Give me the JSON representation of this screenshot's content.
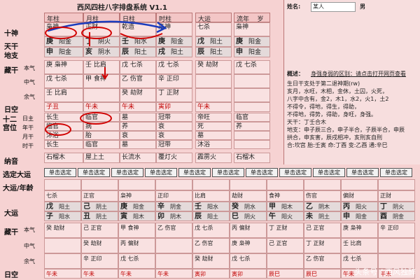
{
  "app": {
    "title": "西风四柱八字排盘系统 V1.1"
  },
  "top": {
    "pillar_headers": [
      "年柱",
      "月柱",
      "日柱",
      "时柱"
    ],
    "dayun_header": "大运",
    "liunian_header": "流年",
    "liunian_value": "岁",
    "name_label": "姓名:",
    "name_value": "某人",
    "gender": "男"
  },
  "left_labels": {
    "shishen": "十神",
    "tiangan": "天干",
    "dizhi": "地支",
    "canggan": "藏干",
    "benqi": "本气",
    "zhongqi": "中气",
    "yuqi": "余气",
    "rikong": "日空",
    "shier": "十二宫位",
    "rizhu": "日主",
    "nianzhu": "年干",
    "yuezhu": "月干",
    "shizhu": "时干",
    "nayin": "纳音",
    "xuanding": "选定大运",
    "dayun_nianling": "大运/年龄",
    "dayun2": "大运",
    "canggan2": "藏干",
    "benqi2": "本气",
    "zhongqi2": "中气",
    "yuqi2": "余气",
    "rikong2": "日空"
  },
  "pillars": [
    {
      "shishen": "枭神",
      "gan": "庚",
      "gan_wx": "阳金",
      "zhi": "申",
      "zhi_wx": "阳金",
      "cang": [
        "庚 枭神",
        "戊 七杀",
        "壬 比肩"
      ],
      "kong": "子丑",
      "s1": "长生",
      "s2": "临官",
      "s3": "沐浴",
      "s4": "长生",
      "nayin": "石榴木"
    },
    {
      "shishen": "正财",
      "gan": "丁",
      "gan_wx": "阴火",
      "zhi": "亥",
      "zhi_wx": "阴水",
      "cang": [
        "壬 比肩",
        "甲 食神",
        ""
      ],
      "kong": "午未",
      "s1": "临官",
      "s2": "病",
      "s3": "胎",
      "s4": "临官",
      "nayin": "屋上土"
    },
    {
      "shishen": "乾造",
      "gan": "壬",
      "gan_wx": "阳水",
      "zhi": "辰",
      "zhi_wx": "阳土",
      "cang": [
        "戊 七杀",
        "乙 伤官",
        "癸 劫财"
      ],
      "kong": "午未",
      "s1": "墓",
      "s2": "养",
      "s3": "衰",
      "s4": "墓",
      "nayin": "长流水"
    },
    {
      "shishen": "枭神",
      "gan": "庚",
      "gan_wx": "阳金",
      "zhi": "戌",
      "zhi_wx": "阳土",
      "cang": [
        "戊 七杀",
        "辛 正印",
        "丁 正财"
      ],
      "kong": "寅卯",
      "s1": "冠带",
      "s2": "衰",
      "s3": "衰",
      "s4": "冠带",
      "nayin": "覆灯火"
    }
  ],
  "dayun_col": {
    "shishen": "七杀",
    "gan": "戊",
    "gan_wx": "阳土",
    "zhi": "辰",
    "zhi_wx": "阳土",
    "cang": [
      "癸 劫财"
    ],
    "kong": "午未",
    "s1": "帝旺",
    "s2": "死",
    "s3": "墓",
    "s4": "沐浴",
    "nayin": "霹雳火"
  },
  "liunian_col": {
    "shishen": "枭神",
    "gan": "庚",
    "gan_wx": "阳金",
    "zhi": "申",
    "zhi_wx": "阳金",
    "cang": [
      "戊 七杀"
    ],
    "kong": "",
    "s1": "临官",
    "s2": "养",
    "s3": "",
    "s4": "",
    "nayin": "石榴木"
  },
  "info": {
    "line1": "概述：",
    "line1b": "身强身弱的区别：请点击打开网页查看",
    "lines": [
      "生日干支处于第二退神期(rw)",
      "亥月，水旺，木相，金休，土囚，火死，",
      "八字中含有，金2，木1，水2，火1，土2",
      "不得令，得地，得生，得助，",
      "不得地，得势，得助，身旺，身强。",
      "天干：丁壬合木",
      "地支：申子辰三合，申子半合，子辰半合，申辰",
      "拱合，申亥害，辰戌相冲，亥刑亥自刑",
      "合:坎宫  胎:壬寅  命:丁酉  变:乙酉  通:辛巳"
    ],
    "mingzhu": "命:坎宫  胎:壬寅  命:丁酉  变:乙酉  通:辛巳"
  },
  "select_buttons": [
    "单击选定",
    "单击选定",
    "单击选定",
    "单击选定",
    "单击选定",
    "单击选定",
    "单击选定",
    "单击选定",
    "单击选定",
    "单击选定",
    "单击选定"
  ],
  "dayun_table": {
    "cols": [
      {
        "shishen": "七杀",
        "gan": "戊",
        "gw": "阳土",
        "zhi": "子",
        "zw": "阳水",
        "c": [
          "癸 劫财"
        ],
        "kong": "午未"
      },
      {
        "shishen": "正官",
        "gan": "己",
        "gw": "阴土",
        "zhi": "丑",
        "zw": "阴土",
        "c": [
          "己 正官",
          "癸 劫财",
          "辛 正印"
        ],
        "kong": "午未"
      },
      {
        "shishen": "枭神",
        "gan": "庚",
        "gw": "阳金",
        "zhi": "寅",
        "zw": "阳木",
        "c": [
          "甲 食神",
          "丙 偏财",
          "戊 七杀"
        ],
        "kong": "午未"
      },
      {
        "shishen": "正印",
        "gan": "辛",
        "gw": "阴金",
        "zhi": "卯",
        "zw": "阴木",
        "c": [
          "乙 伤官"
        ],
        "kong": "午未"
      },
      {
        "shishen": "比肩",
        "gan": "壬",
        "gw": "阳水",
        "zhi": "辰",
        "zw": "阳土",
        "c": [
          "戊 七杀",
          "乙 伤官",
          "癸 劫财"
        ],
        "kong": "寅卯"
      },
      {
        "shishen": "劫财",
        "gan": "癸",
        "gw": "阴水",
        "zhi": "巳",
        "zw": "阴火",
        "c": [
          "丙 偏财",
          "庚 枭神",
          "戊 七杀"
        ],
        "kong": "寅卯"
      },
      {
        "shishen": "食神",
        "gan": "甲",
        "gw": "阳木",
        "zhi": "午",
        "zw": "阳火",
        "c": [
          "丁 正财",
          "己 正官"
        ],
        "kong": "辰巳"
      },
      {
        "shishen": "伤官",
        "gan": "乙",
        "gw": "阴木",
        "zhi": "未",
        "zw": "阴土",
        "c": [
          "己 正官",
          "丁 正财",
          "乙 伤官"
        ],
        "kong": "辰巳"
      },
      {
        "shishen": "偏财",
        "gan": "丙",
        "gw": "阳火",
        "zhi": "申",
        "zw": "阳金",
        "c": [
          "庚 枭神",
          "壬 比肩",
          "戊 七杀"
        ],
        "kong": "午未"
      },
      {
        "shishen": "正财",
        "gan": "丁",
        "gw": "阴火",
        "zhi": "酉",
        "zw": "阴金",
        "c": [
          "辛 正印"
        ],
        "kong": "午未"
      }
    ]
  },
  "watermark": "头条号 / 西风独醉",
  "colors": {
    "bg": "#f4c9c9",
    "cell": "#f9e1e1",
    "accent": "#c00000",
    "blue": "#1a3bbd"
  }
}
